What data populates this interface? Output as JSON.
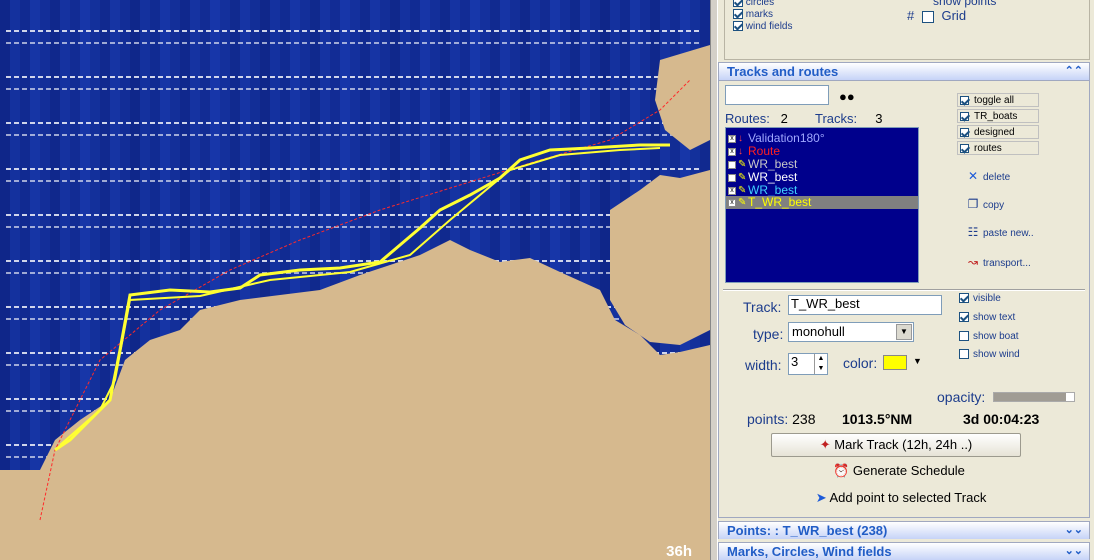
{
  "map": {
    "hour_label": "36h",
    "colors": {
      "sea": "#0a1a7a",
      "land": "#d6b98e",
      "track": "#ffff33",
      "route": "#ff2a2a",
      "grid_text": "#ffffff"
    }
  },
  "top_box": {
    "items": [
      {
        "label": "circles",
        "checked": true
      },
      {
        "label": "marks",
        "checked": true
      },
      {
        "label": "wind fields",
        "checked": true
      }
    ],
    "show_points_label": "show points",
    "grid_label": "Grid",
    "grid_checked": false
  },
  "tracks_routes": {
    "title": "Tracks and routes",
    "search_value": "",
    "routes_label": "Routes:",
    "routes_count": "2",
    "tracks_label": "Tracks:",
    "tracks_count": "3",
    "tree_items": [
      {
        "name": "Validation180°",
        "color": "#a0a8ff"
      },
      {
        "name": "Route",
        "color": "#ff2020"
      },
      {
        "name": "WR_best",
        "color": "#c8c8c8"
      },
      {
        "name": "WR_best",
        "color": "#ffffff"
      },
      {
        "name": "WR_best",
        "color": "#40d0ff"
      },
      {
        "name": "T_WR_best",
        "color": "#ffff00"
      }
    ],
    "toggles": [
      {
        "label": "toggle all",
        "checked": true
      },
      {
        "label": "TR_boats",
        "checked": true
      },
      {
        "label": "designed",
        "checked": true
      },
      {
        "label": "routes",
        "checked": true
      }
    ],
    "actions": [
      {
        "label": "delete",
        "icon": "x-icon"
      },
      {
        "label": "copy",
        "icon": "copy-icon"
      },
      {
        "label": "paste new..",
        "icon": "paste-icon"
      },
      {
        "label": "transport...",
        "icon": "transport-icon"
      }
    ]
  },
  "track_props": {
    "track_label": "Track:",
    "track_value": "T_WR_best",
    "type_label": "type:",
    "type_value": "monohull",
    "width_label": "width:",
    "width_value": "3",
    "color_label": "color:",
    "color_value": "#ffff00",
    "options": [
      {
        "label": "visible",
        "checked": true
      },
      {
        "label": "show text",
        "checked": true
      },
      {
        "label": "show boat",
        "checked": false
      },
      {
        "label": "show wind",
        "checked": false
      }
    ],
    "opacity_label": "opacity:",
    "opacity_value": 0.9,
    "points_label": "points:",
    "points_value": "238",
    "distance": "1013.5°NM",
    "duration": "3d 00:04:23",
    "mark_track_label": "Mark Track (12h, 24h ..)",
    "generate_schedule_label": "Generate Schedule",
    "add_point_label": "Add point to selected Track"
  },
  "points_section": {
    "title": "Points: : T_WR_best (238)"
  },
  "marks_section": {
    "title": "Marks, Circles, Wind fields"
  }
}
